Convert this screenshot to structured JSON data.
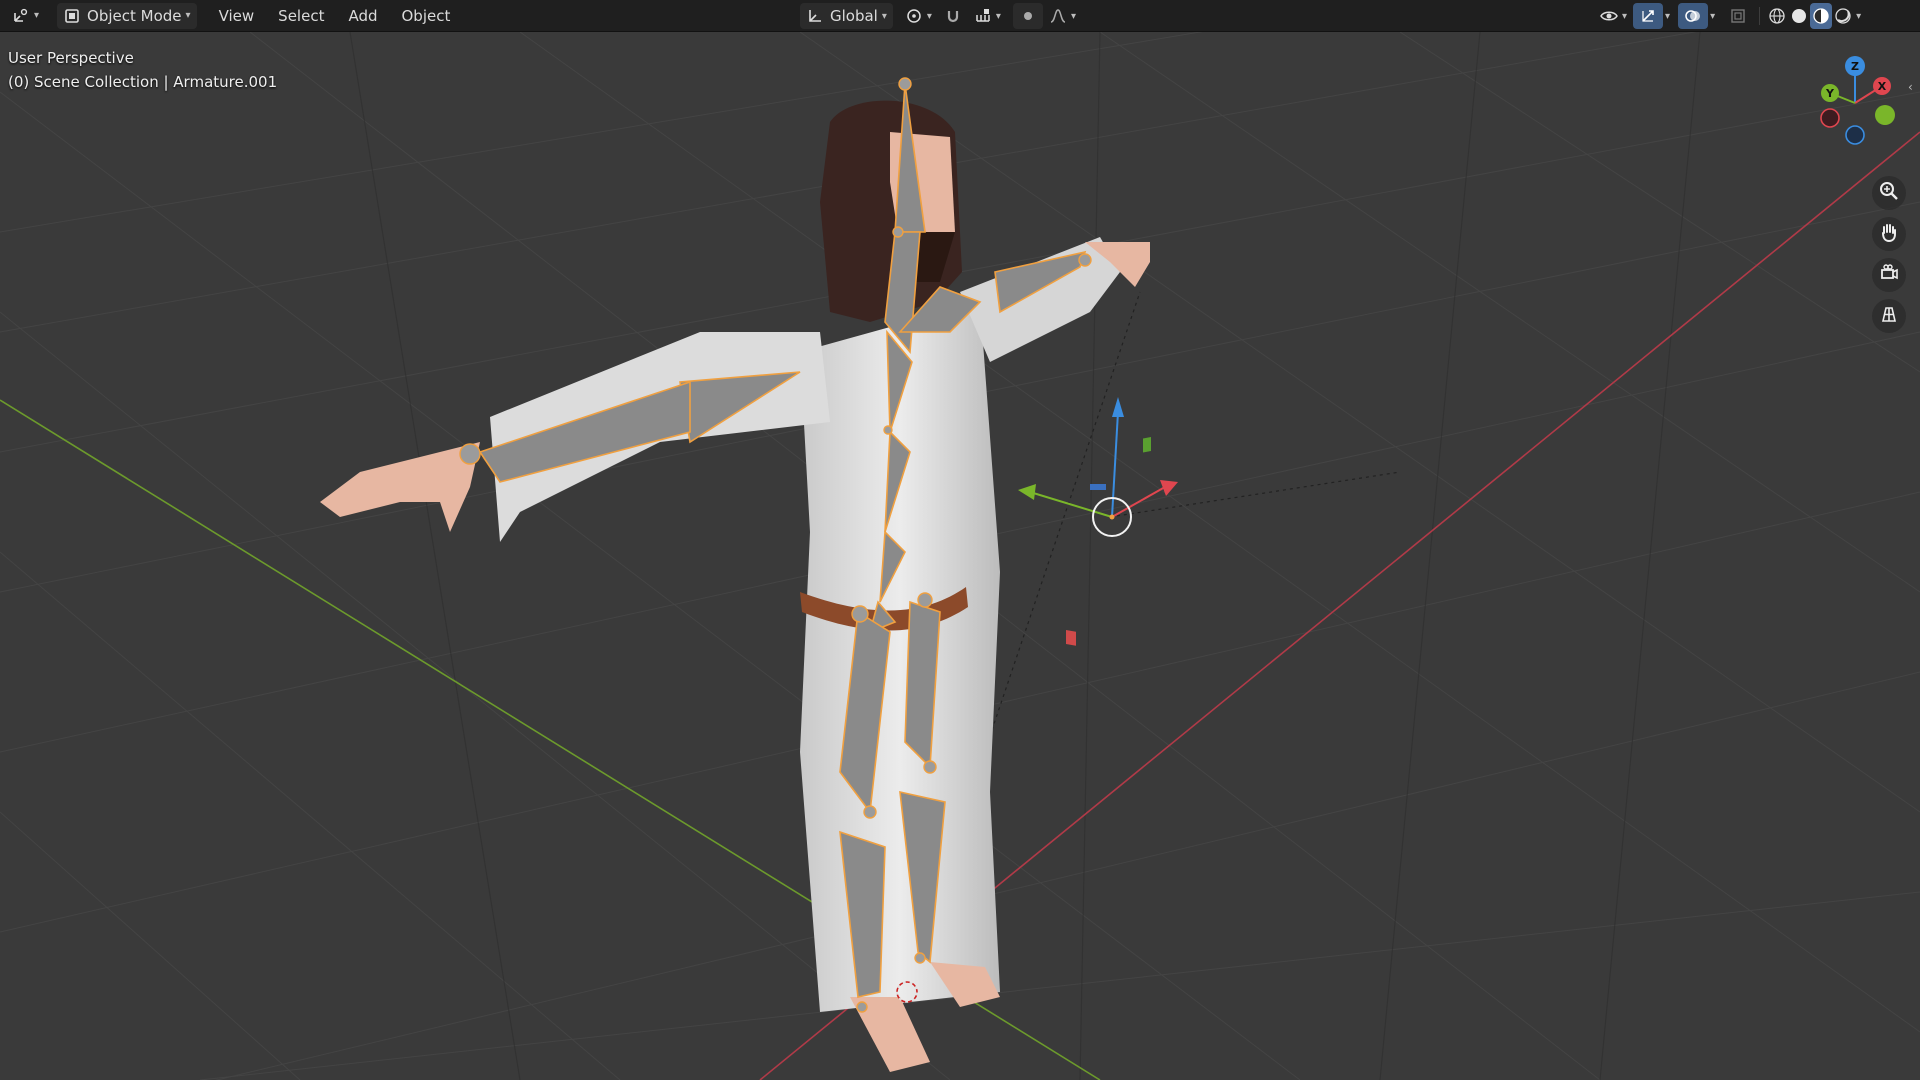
{
  "header": {
    "editor_type_icon": "3d-viewport-icon",
    "mode_label": "Object Mode",
    "menus": [
      "View",
      "Select",
      "Add",
      "Object"
    ],
    "transform_orientation": "Global",
    "icons_center": [
      "transform-pivot-icon",
      "snap-icon",
      "snap-increment-icon",
      "proportional-edit-icon",
      "falloff-icon"
    ],
    "icons_right": [
      "visibility-icon",
      "gizmo-icon",
      "overlay-icon",
      "xray-icon",
      "wireframe-shading-icon",
      "solid-shading-icon",
      "material-shading-icon",
      "rendered-shading-icon"
    ]
  },
  "viewport": {
    "perspective_label": "User Perspective",
    "collection_label": "(0) Scene Collection | Armature.001",
    "colors": {
      "background": "#3a3a3a",
      "grid": "#434343",
      "x_axis": "#b03a48",
      "y_axis": "#6c9a2c",
      "bone_outline": "#f0a040",
      "bone_fill": "#8a8a8a",
      "robe": "#d8d8d8",
      "skin": "#e7b7a2",
      "hair": "#3a2420"
    },
    "nav_gizmo": {
      "axes": [
        "X",
        "Y",
        "Z"
      ],
      "colors": {
        "x": "#e0464f",
        "y": "#7ab62a",
        "z": "#3a8de0"
      }
    },
    "nav_tools": [
      "zoom-icon",
      "pan-hand-icon",
      "camera-view-icon",
      "ortho-grid-icon"
    ]
  }
}
